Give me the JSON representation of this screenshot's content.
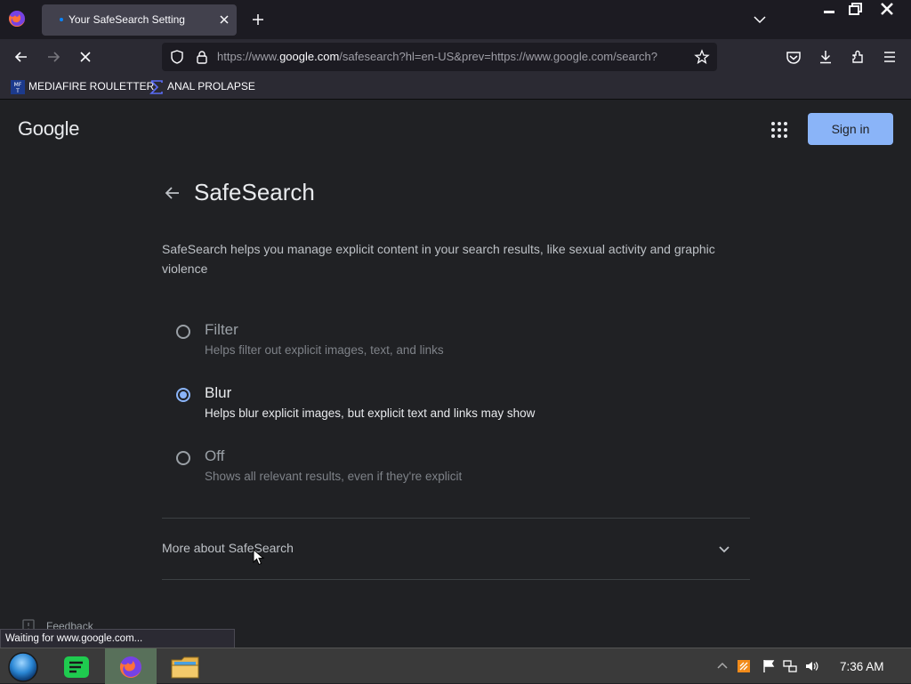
{
  "browser": {
    "tab": {
      "title": "Your SafeSearch Setting"
    },
    "url": {
      "prefix": "https://www.",
      "host": "google.com",
      "rest": "/safesearch?hl=en-US&prev=https://www.google.com/search?"
    },
    "bookmarks": [
      {
        "label": "MEDIAFIRE ROULETTER",
        "icon_text": "MF\nT"
      },
      {
        "label": "ANAL PROLAPSE"
      }
    ],
    "status_text": "Waiting for www.google.com..."
  },
  "page": {
    "logo": "Google",
    "signin_label": "Sign in",
    "title": "SafeSearch",
    "description": "SafeSearch helps you manage explicit content in your search results, like sexual activity and graphic violence",
    "options": [
      {
        "label": "Filter",
        "desc": "Helps filter out explicit images, text, and links",
        "selected": false
      },
      {
        "label": "Blur",
        "desc": "Helps blur explicit images, but explicit text and links may show",
        "selected": true
      },
      {
        "label": "Off",
        "desc": "Shows all relevant results, even if they're explicit",
        "selected": false
      }
    ],
    "more_about": "More about SafeSearch",
    "feedback": "Feedback"
  },
  "taskbar": {
    "time": "7:36 AM"
  },
  "colors": {
    "accent": "#8ab4f8",
    "page_bg": "#202124",
    "tab_active": "#42414d"
  }
}
